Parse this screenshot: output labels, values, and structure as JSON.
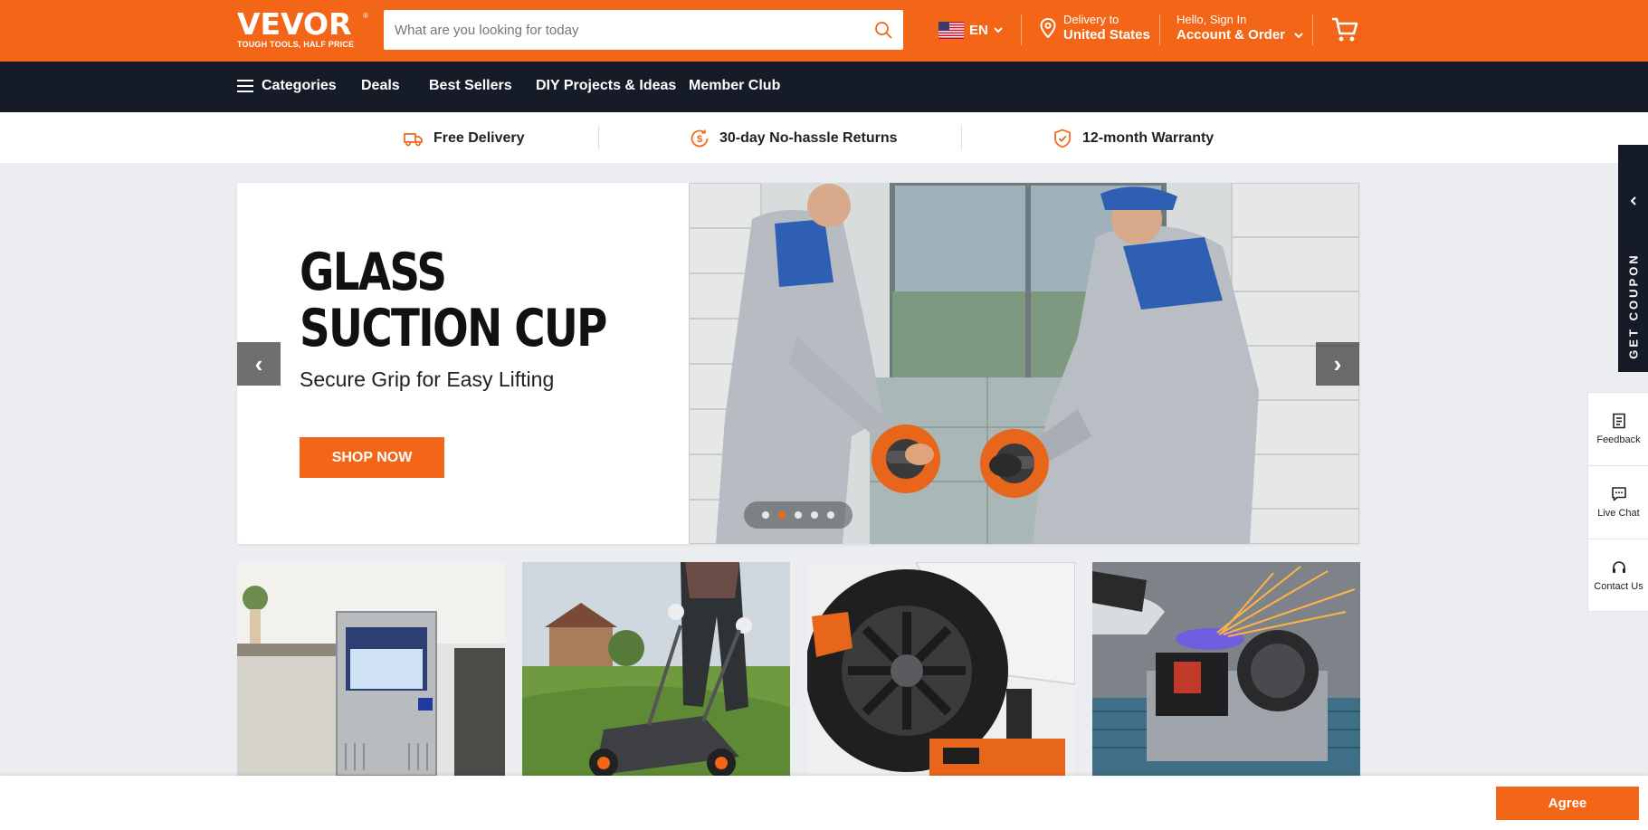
{
  "header": {
    "logo_text": "VEVOR",
    "logo_tagline": "TOUGH TOOLS, HALF PRICE",
    "search_placeholder": "What are you looking for today",
    "language": "EN",
    "delivery_label": "Delivery to",
    "delivery_location": "United States",
    "account_greeting": "Hello, Sign In",
    "account_label": "Account & Order",
    "icons": [
      "search-icon",
      "us-flag-icon",
      "chevron-down-icon",
      "location-pin-icon",
      "cart-icon"
    ]
  },
  "nav": {
    "items": [
      "Categories",
      "Deals",
      "Best Sellers",
      "DIY Projects & Ideas",
      "Member Club"
    ],
    "icons": [
      "menu-icon"
    ]
  },
  "benefits": [
    {
      "label": "Free Delivery",
      "icon": "delivery-truck-icon"
    },
    {
      "label": "30-day No-hassle Returns",
      "icon": "dollar-return-icon"
    },
    {
      "label": "12-month Warranty",
      "icon": "shield-check-icon"
    }
  ],
  "hero": {
    "title_line1": "GLASS",
    "title_line2": "SUCTION CUP",
    "subtitle": "Secure Grip for Easy Lifting",
    "cta": "SHOP NOW",
    "prev_arrow": "‹",
    "next_arrow": "›",
    "slide_count": 5,
    "active_slide": 2
  },
  "category_tiles": [
    {
      "image": "ice-maker-photo"
    },
    {
      "image": "lawn-mower-photo"
    },
    {
      "image": "car-jack-tire-photo"
    },
    {
      "image": "bench-grinder-photo"
    }
  ],
  "side": {
    "coupon": "GET COUPON",
    "feedback": "Feedback",
    "live_chat": "Live Chat",
    "contact_us": "Contact Us"
  },
  "cookie": {
    "agree": "Agree"
  },
  "colors": {
    "brand_orange": "#f36517",
    "nav_dark": "#151c27",
    "page_bg": "#ecedf1"
  }
}
